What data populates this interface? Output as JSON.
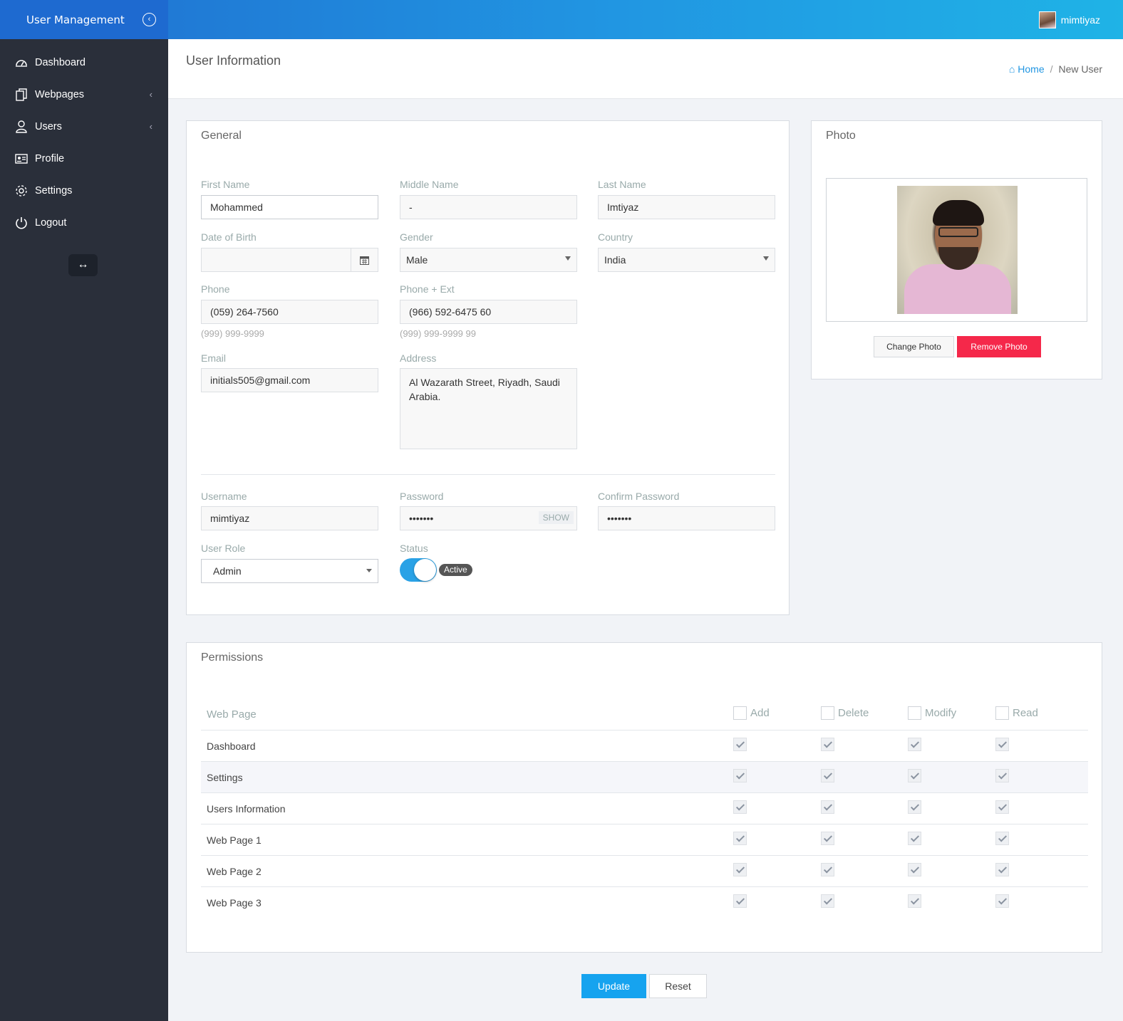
{
  "app": {
    "title": "User Management",
    "username": "mimtiyaz"
  },
  "sidebar": {
    "items": [
      {
        "label": "Dashboard",
        "icon": "dashboard-gauge-icon"
      },
      {
        "label": "Webpages",
        "icon": "pages-icon",
        "caret": true
      },
      {
        "label": "Users",
        "icon": "user-icon",
        "caret": true
      },
      {
        "label": "Profile",
        "icon": "id-card-icon"
      },
      {
        "label": "Settings",
        "icon": "gear-icon"
      },
      {
        "label": "Logout",
        "icon": "power-icon"
      }
    ]
  },
  "header": {
    "title": "User Information",
    "breadcrumb": {
      "home": "Home",
      "sep": "/",
      "current": "New User"
    }
  },
  "general": {
    "title": "General",
    "first_name": {
      "label": "First Name",
      "value": "Mohammed"
    },
    "middle_name": {
      "label": "Middle Name",
      "value": "-"
    },
    "last_name": {
      "label": "Last Name",
      "value": "Imtiyaz"
    },
    "dob": {
      "label": "Date of Birth",
      "value": ""
    },
    "gender": {
      "label": "Gender",
      "value": "Male"
    },
    "country": {
      "label": "Country",
      "value": "India"
    },
    "phone": {
      "label": "Phone",
      "value": "(059) 264-7560",
      "hint": "(999) 999-9999"
    },
    "phone_ext": {
      "label": "Phone + Ext",
      "value": "(966) 592-6475 60",
      "hint": "(999) 999-9999 99"
    },
    "email": {
      "label": "Email",
      "value": "initials505@gmail.com"
    },
    "address": {
      "label": "Address",
      "value": "Al Wazarath Street, Riyadh, Saudi Arabia."
    },
    "username": {
      "label": "Username",
      "value": "mimtiyaz"
    },
    "password": {
      "label": "Password",
      "value": "•••••••",
      "show_label": "SHOW"
    },
    "confirm_password": {
      "label": "Confirm Password",
      "value": "•••••••"
    },
    "role": {
      "label": "User Role",
      "value": "Admin"
    },
    "status": {
      "label": "Status",
      "value": "Active",
      "on": true
    }
  },
  "photo": {
    "title": "Photo",
    "change_label": "Change Photo",
    "remove_label": "Remove Photo"
  },
  "permissions": {
    "title": "Permissions",
    "columns": [
      "Web Page",
      "Add",
      "Delete",
      "Modify",
      "Read"
    ],
    "rows": [
      {
        "name": "Dashboard",
        "add": true,
        "delete": true,
        "modify": true,
        "read": true
      },
      {
        "name": "Settings",
        "add": true,
        "delete": true,
        "modify": true,
        "read": true
      },
      {
        "name": "Users Information",
        "add": true,
        "delete": true,
        "modify": true,
        "read": true
      },
      {
        "name": "Web Page 1",
        "add": true,
        "delete": true,
        "modify": true,
        "read": true
      },
      {
        "name": "Web Page 2",
        "add": true,
        "delete": true,
        "modify": true,
        "read": true
      },
      {
        "name": "Web Page 3",
        "add": true,
        "delete": true,
        "modify": true,
        "read": true
      }
    ]
  },
  "actions": {
    "update_label": "Update",
    "reset_label": "Reset"
  },
  "colors": {
    "primary": "#16a3ef",
    "danger": "#f5284a",
    "sidebar": "#2a2f3a",
    "topbar": "#1e6ad0"
  }
}
